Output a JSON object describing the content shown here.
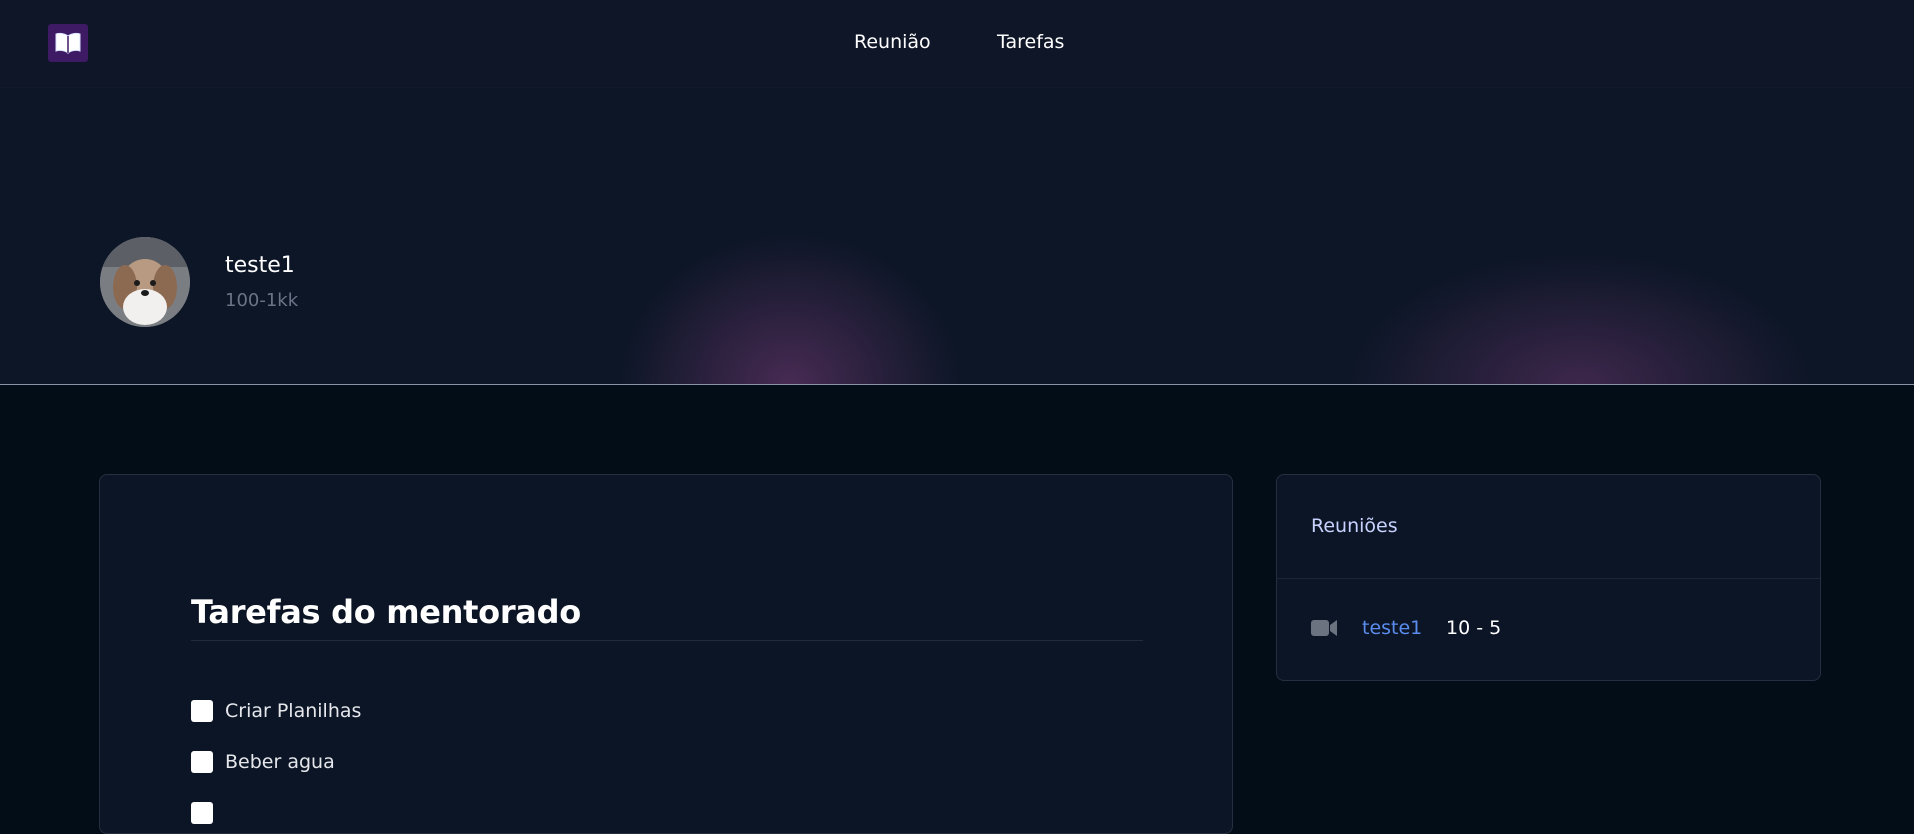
{
  "nav": {
    "logo_icon": "open-book-icon",
    "links": [
      "Reunião",
      "Tarefas"
    ]
  },
  "profile": {
    "name": "teste1",
    "subtitle": "100-1kk",
    "avatar": "dog-photo-avatar"
  },
  "tasks": {
    "title": "Tarefas do mentorado",
    "items": [
      {
        "label": "Criar Planilhas",
        "checked": false
      },
      {
        "label": "Beber agua",
        "checked": false
      },
      {
        "label": "",
        "checked": false
      }
    ]
  },
  "meetings": {
    "title": "Reuniões",
    "items": [
      {
        "icon": "video-camera-icon",
        "name": "teste1",
        "time": "10 - 5"
      }
    ]
  },
  "colors": {
    "accent_link": "#5b8def",
    "logo_bg": "#3d1a63",
    "page_bg": "#030d17"
  }
}
